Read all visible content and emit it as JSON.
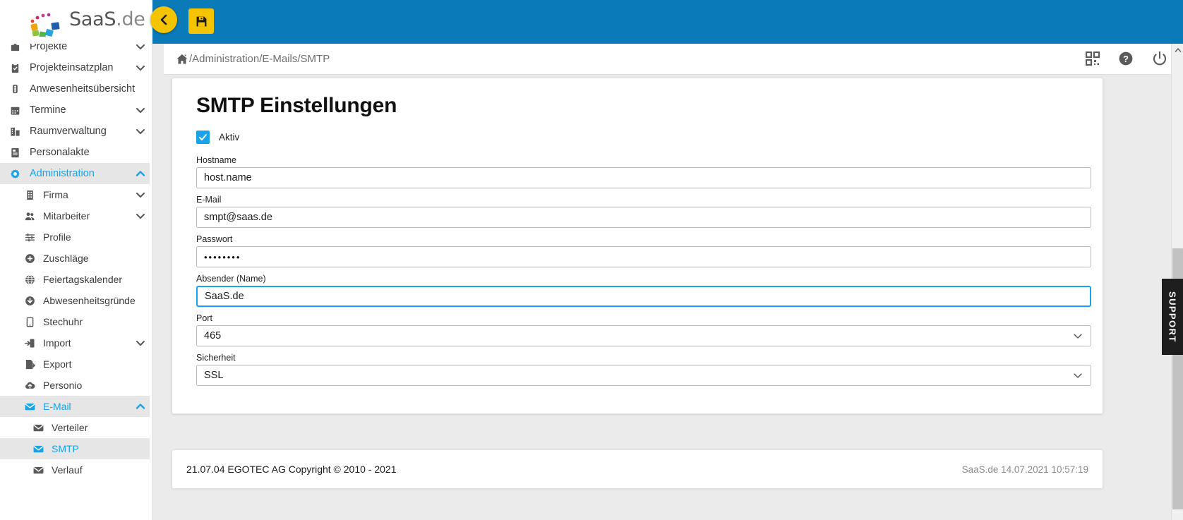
{
  "brand": {
    "name": "SaaS.de",
    "name_main": "SaaS",
    "name_tld": ".de",
    "accent_blue": "#0a7ab8",
    "accent_yellow": "#f5c400",
    "link_blue": "#1aa2e8"
  },
  "topbar": {
    "collapse_icon": "chevron-left-icon",
    "save_icon": "floppy-disk-save-icon"
  },
  "breadcrumb": {
    "home_icon": "home-icon",
    "path": "/Administration/E-Mails/SMTP",
    "actions": [
      {
        "icon": "qr-code-icon",
        "name": "qr-code-button"
      },
      {
        "icon": "help-circle-icon",
        "name": "help-button"
      },
      {
        "icon": "power-icon",
        "name": "logout-button"
      }
    ]
  },
  "sidebar": {
    "scroll_up_icon": "chevron-up-icon",
    "items": [
      {
        "label": "Projekte",
        "icon": "briefcase-icon",
        "chevron": "down",
        "level": 0,
        "state": "partial"
      },
      {
        "label": "Projekteinsatzplan",
        "icon": "clipboard-check-icon",
        "chevron": "down",
        "level": 0,
        "state": "normal"
      },
      {
        "label": "Anwesenheitsübersicht",
        "icon": "traffic-light-icon",
        "chevron": "",
        "level": 0,
        "state": "normal"
      },
      {
        "label": "Termine",
        "icon": "calendar-icon",
        "chevron": "down",
        "level": 0,
        "state": "normal"
      },
      {
        "label": "Raumverwaltung",
        "icon": "building-icon",
        "chevron": "down",
        "level": 0,
        "state": "normal"
      },
      {
        "label": "Personalakte",
        "icon": "file-person-icon",
        "chevron": "",
        "level": 0,
        "state": "normal"
      },
      {
        "label": "Administration",
        "icon": "gear-icon",
        "chevron": "up",
        "level": 0,
        "state": "active"
      },
      {
        "label": "Firma",
        "icon": "office-building-icon",
        "chevron": "down",
        "level": 1,
        "state": "normal"
      },
      {
        "label": "Mitarbeiter",
        "icon": "users-icon",
        "chevron": "down",
        "level": 1,
        "state": "normal"
      },
      {
        "label": "Profile",
        "icon": "sliders-icon",
        "chevron": "",
        "level": 1,
        "state": "normal"
      },
      {
        "label": "Zuschläge",
        "icon": "plus-circle-icon",
        "chevron": "",
        "level": 1,
        "state": "normal"
      },
      {
        "label": "Feiertagskalender",
        "icon": "globe-icon",
        "chevron": "",
        "level": 1,
        "state": "normal"
      },
      {
        "label": "Abwesenheitsgründe",
        "icon": "arrow-down-circle-icon",
        "chevron": "",
        "level": 1,
        "state": "normal"
      },
      {
        "label": "Stechuhr",
        "icon": "tablet-icon",
        "chevron": "",
        "level": 1,
        "state": "normal"
      },
      {
        "label": "Import",
        "icon": "import-icon",
        "chevron": "down",
        "level": 1,
        "state": "normal"
      },
      {
        "label": "Export",
        "icon": "export-icon",
        "chevron": "",
        "level": 1,
        "state": "normal"
      },
      {
        "label": "Personio",
        "icon": "cloud-upload-icon",
        "chevron": "",
        "level": 1,
        "state": "normal"
      },
      {
        "label": "E-Mail",
        "icon": "envelope-icon",
        "chevron": "up",
        "level": 1,
        "state": "active"
      },
      {
        "label": "Verteiler",
        "icon": "envelope-icon",
        "chevron": "",
        "level": 2,
        "state": "normal"
      },
      {
        "label": "SMTP",
        "icon": "envelope-icon",
        "chevron": "",
        "level": 2,
        "state": "selected"
      },
      {
        "label": "Verlauf",
        "icon": "envelope-icon",
        "chevron": "",
        "level": 2,
        "state": "normal"
      }
    ]
  },
  "page": {
    "title": "SMTP Einstellungen",
    "active_checkbox": {
      "label": "Aktiv",
      "checked": true
    },
    "fields": [
      {
        "label": "Hostname",
        "value": "host.name",
        "type": "text",
        "focused": false
      },
      {
        "label": "E-Mail",
        "value": "smpt@saas.de",
        "type": "text",
        "focused": false
      },
      {
        "label": "Passwort",
        "value": "••••••••",
        "type": "password",
        "focused": false
      },
      {
        "label": "Absender (Name)",
        "value": "SaaS.de",
        "type": "text",
        "focused": true
      },
      {
        "label": "Port",
        "value": "465",
        "type": "select",
        "focused": false
      },
      {
        "label": "Sicherheit",
        "value": "SSL",
        "type": "select",
        "focused": false
      }
    ]
  },
  "footer": {
    "left": "21.07.04 EGOTEC AG Copyright © 2010 - 2021",
    "right": "SaaS.de  14.07.2021 10:57:19"
  },
  "support_tab": {
    "label": "SUPPORT"
  }
}
